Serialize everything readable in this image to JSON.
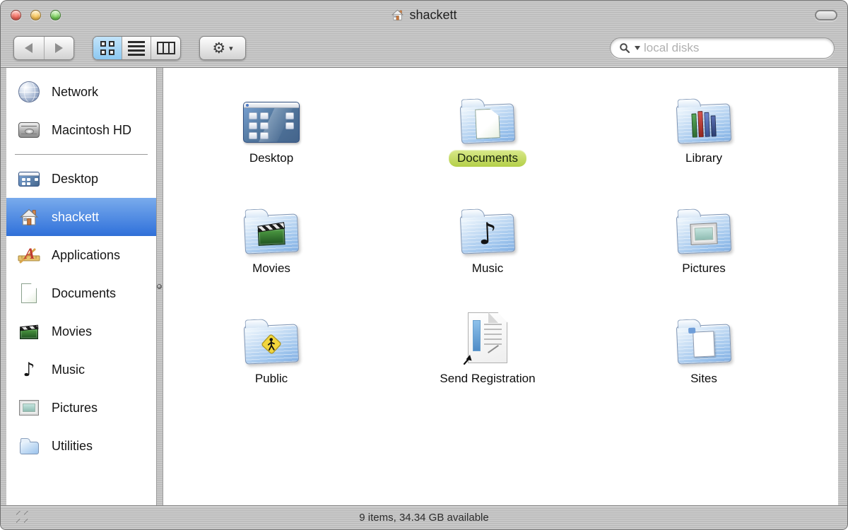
{
  "window": {
    "title": "shackett",
    "title_icon": "home-icon"
  },
  "titlebar": {
    "buttons": [
      "close",
      "minimize",
      "zoom"
    ]
  },
  "toolbar": {
    "back_icon": "back-arrow-icon",
    "forward_icon": "forward-arrow-icon",
    "view_modes": [
      "icon-view",
      "list-view",
      "column-view"
    ],
    "active_view": "icon-view",
    "action_icon": "gear-icon",
    "search_placeholder": "local disks",
    "search_icon": "magnifier-icon"
  },
  "glyphs": {
    "gear": "⚙",
    "caret_down": "▾",
    "music_note": "♪"
  },
  "sidebar": {
    "volumes": [
      {
        "label": "Network",
        "icon": "network-globe-icon"
      },
      {
        "label": "Macintosh HD",
        "icon": "hard-drive-icon"
      }
    ],
    "places": [
      {
        "label": "Desktop",
        "icon": "desktop-mini-icon",
        "selected": false
      },
      {
        "label": "shackett",
        "icon": "home-icon",
        "selected": true
      },
      {
        "label": "Applications",
        "icon": "applications-icon",
        "selected": false
      },
      {
        "label": "Documents",
        "icon": "document-icon",
        "selected": false
      },
      {
        "label": "Movies",
        "icon": "movies-clapper-icon",
        "selected": false
      },
      {
        "label": "Music",
        "icon": "music-note-icon",
        "selected": false
      },
      {
        "label": "Pictures",
        "icon": "pictures-frame-icon",
        "selected": false
      },
      {
        "label": "Utilities",
        "icon": "folder-icon",
        "selected": false
      }
    ]
  },
  "main": {
    "items": [
      {
        "label": "Desktop",
        "icon": "desktop-icon",
        "highlighted": false
      },
      {
        "label": "Documents",
        "icon": "documents-folder-icon",
        "highlighted": true
      },
      {
        "label": "Library",
        "icon": "library-folder-icon",
        "highlighted": false
      },
      {
        "label": "Movies",
        "icon": "movies-folder-icon",
        "highlighted": false
      },
      {
        "label": "Music",
        "icon": "music-folder-icon",
        "highlighted": false
      },
      {
        "label": "Pictures",
        "icon": "pictures-folder-icon",
        "highlighted": false
      },
      {
        "label": "Public",
        "icon": "public-folder-icon",
        "highlighted": false
      },
      {
        "label": "Send Registration",
        "icon": "send-registration-file-icon",
        "highlighted": false
      },
      {
        "label": "Sites",
        "icon": "sites-folder-icon",
        "highlighted": false
      }
    ]
  },
  "statusbar": {
    "text": "9 items, 34.34 GB available"
  },
  "colors": {
    "selection_blue": "#3a79dd",
    "label_highlight_green": "#bfd75a",
    "metal_gray": "#bfbfbf",
    "view_active_blue": "#8cc8f1"
  }
}
